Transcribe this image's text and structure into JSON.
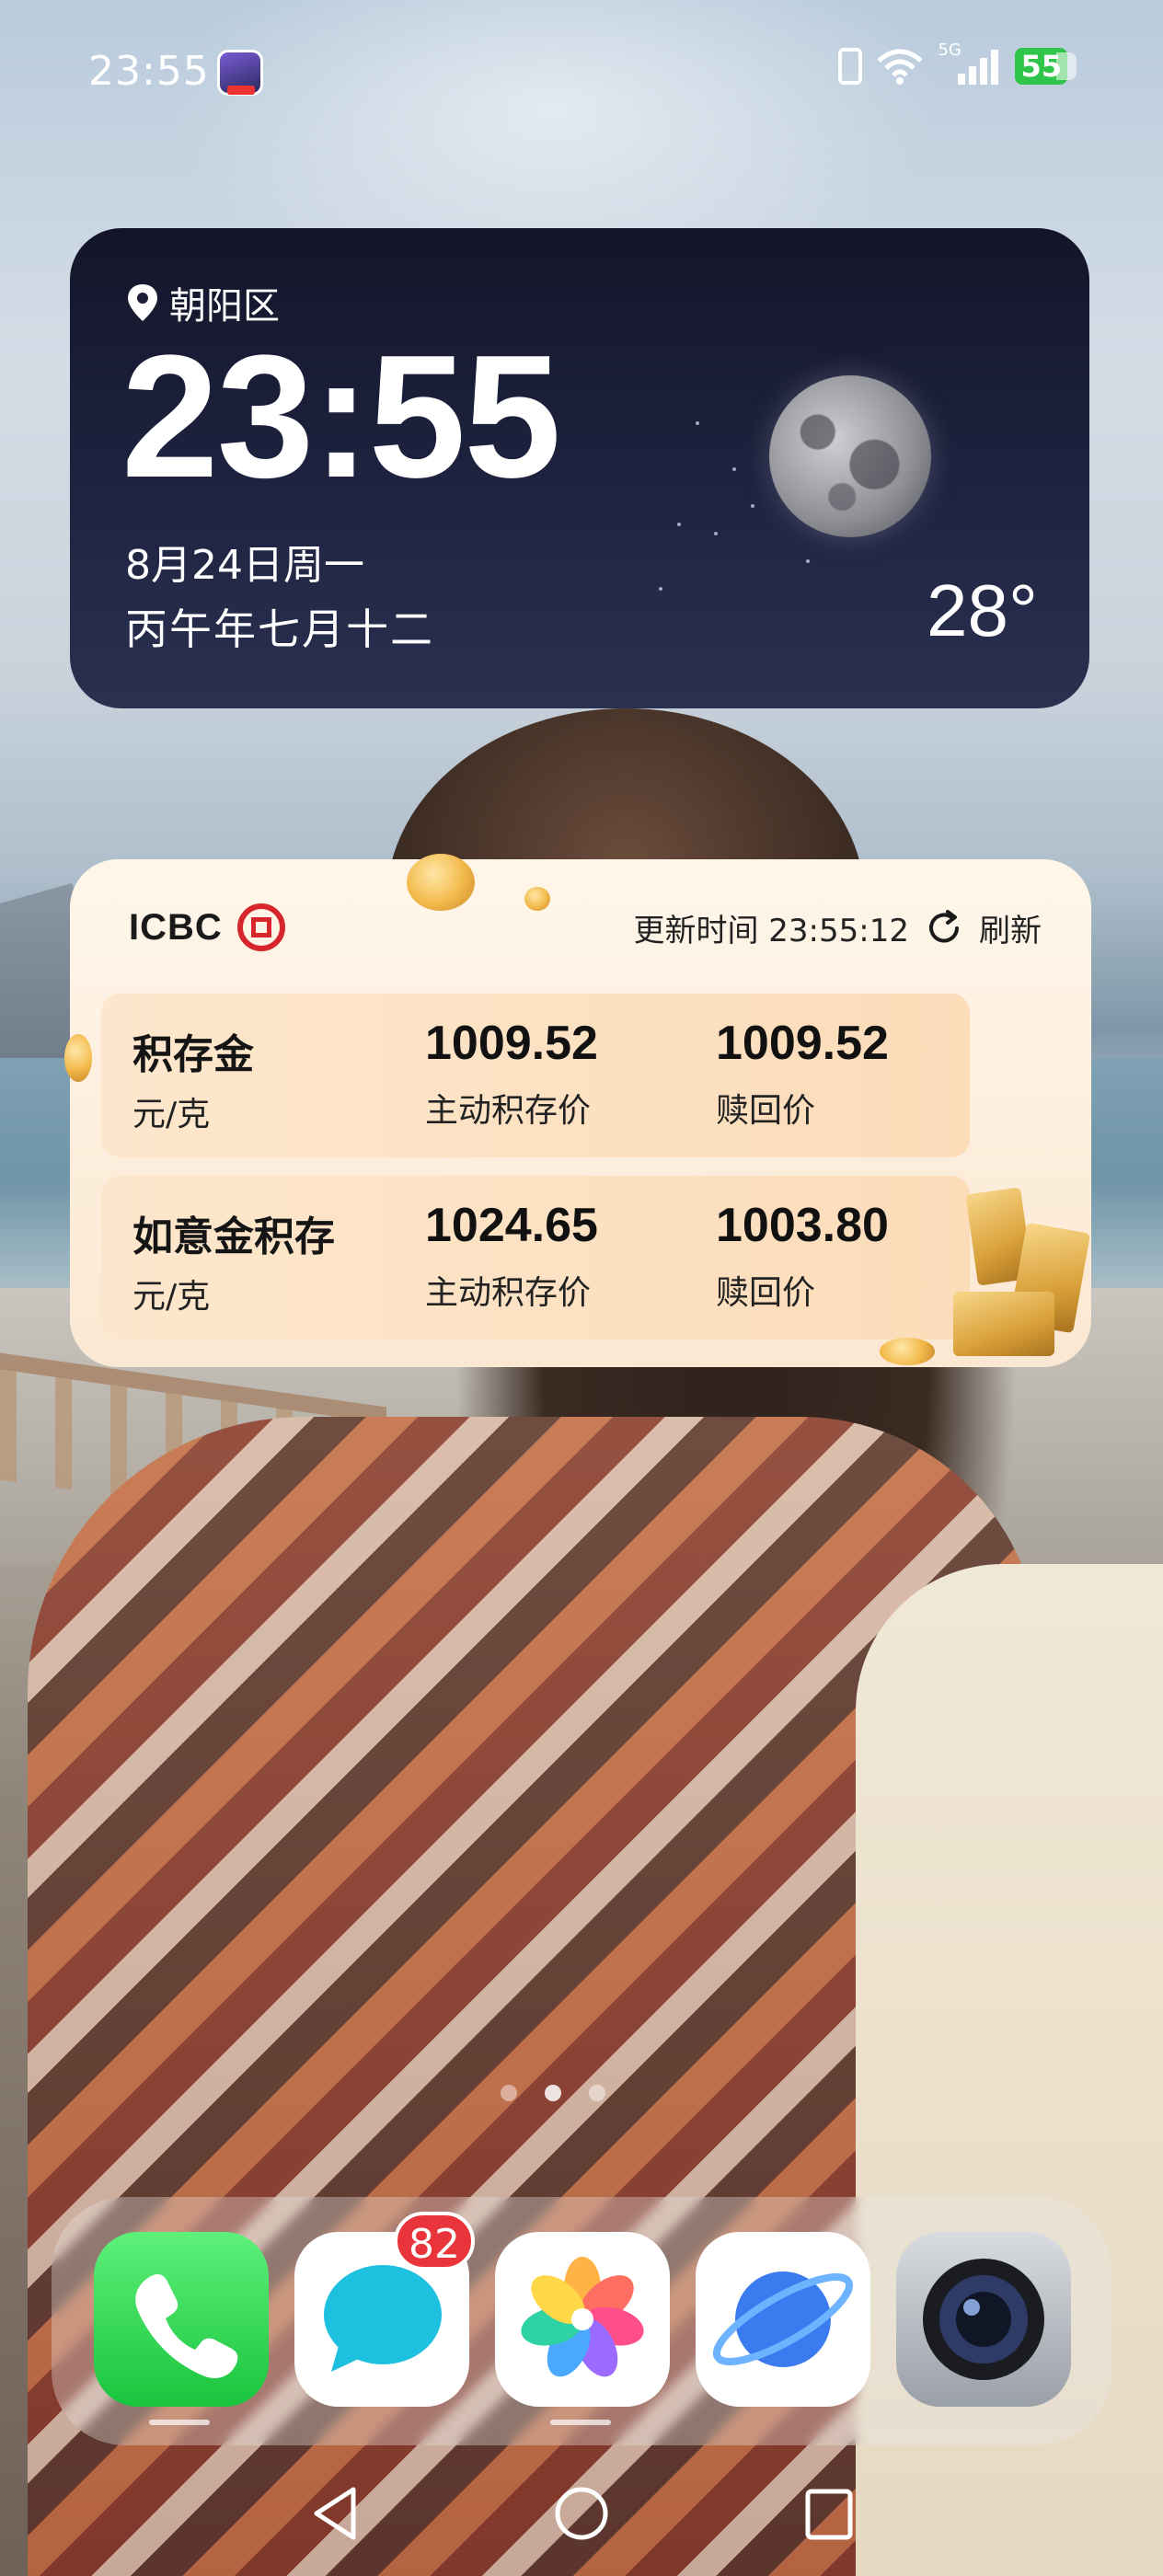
{
  "status_bar": {
    "time": "23:55",
    "network_type": "5G",
    "battery": "55"
  },
  "clock_widget": {
    "location": "朝阳区",
    "time": "23:55",
    "date": "8月24日周一",
    "lunar_date": "丙午年七月十二",
    "temperature": "28°"
  },
  "icbc_widget": {
    "brand": "ICBC",
    "update_label": "更新时间 23:55:12",
    "refresh_label": "刷新",
    "rows": [
      {
        "name": "积存金",
        "unit": "元/克",
        "price1": "1009.52",
        "price1_label": "主动积存价",
        "price2": "1009.52",
        "price2_label": "赎回价"
      },
      {
        "name": "如意金积存",
        "unit": "元/克",
        "price1": "1024.65",
        "price1_label": "主动积存价",
        "price2": "1003.80",
        "price2_label": "赎回价"
      }
    ]
  },
  "page_indicator": {
    "count": 3,
    "active_index": 1
  },
  "dock": {
    "apps": [
      {
        "icon": "phone-icon"
      },
      {
        "icon": "messages-icon",
        "badge": "82"
      },
      {
        "icon": "photos-icon"
      },
      {
        "icon": "browser-icon"
      },
      {
        "icon": "camera-icon"
      }
    ]
  },
  "nav_bar": {
    "buttons": [
      "back-icon",
      "home-icon",
      "recents-icon"
    ]
  }
}
